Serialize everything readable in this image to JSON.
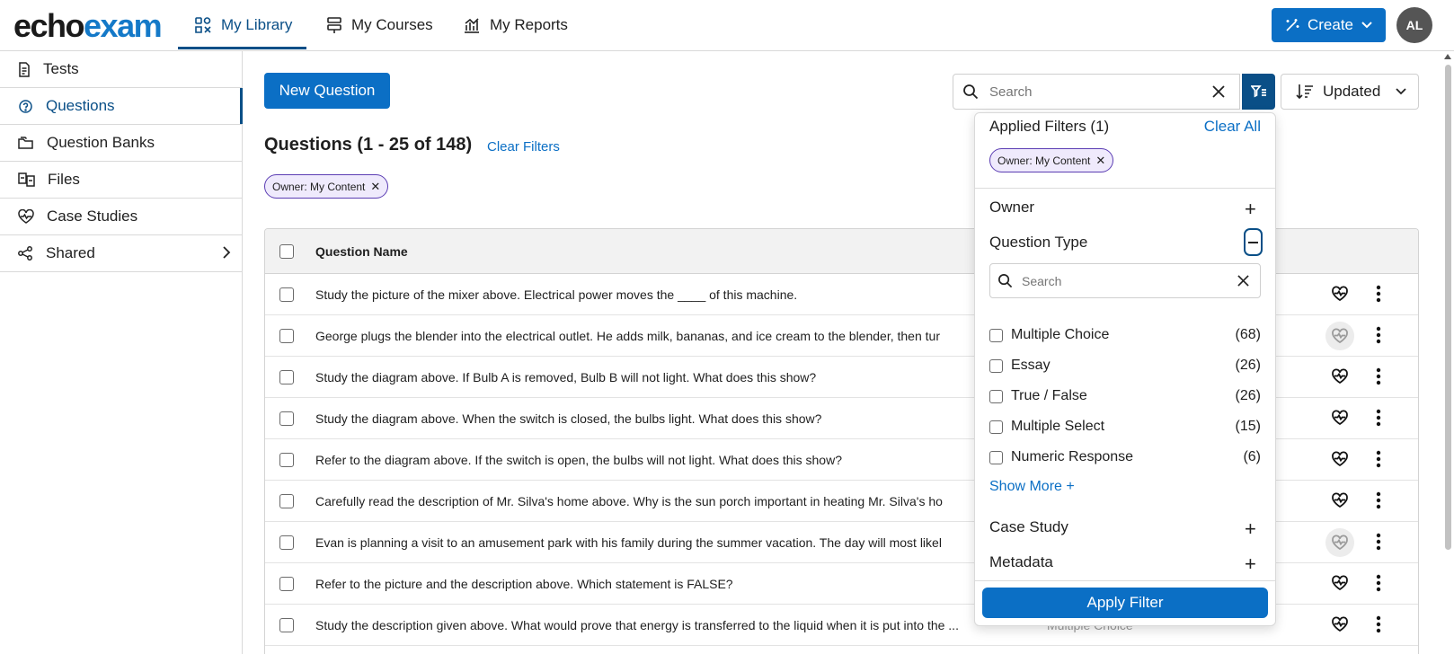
{
  "header": {
    "logo_part1": "echo",
    "logo_part2": "exam",
    "tabs": [
      {
        "label": "My Library",
        "icon": "library-icon"
      },
      {
        "label": "My Courses",
        "icon": "courses-icon"
      },
      {
        "label": "My Reports",
        "icon": "reports-icon"
      }
    ],
    "create_label": "Create",
    "avatar_initials": "AL",
    "accent_color": "#0b6fc5"
  },
  "sidebar": {
    "items": [
      {
        "label": "Tests",
        "icon": "document-icon"
      },
      {
        "label": "Questions",
        "icon": "question-gear-icon"
      },
      {
        "label": "Question Banks",
        "icon": "folder-icon"
      },
      {
        "label": "Files",
        "icon": "files-icon"
      },
      {
        "label": "Case Studies",
        "icon": "heart-pulse-icon"
      },
      {
        "label": "Shared",
        "icon": "share-icon"
      }
    ]
  },
  "main": {
    "new_question_label": "New Question",
    "title": "Questions (1 - 25 of 148)",
    "clear_filters_label": "Clear Filters",
    "chip_label": "Owner: My Content",
    "search_placeholder": "Search",
    "sort_label": "Updated",
    "table": {
      "column_question_name": "Question Name",
      "rows": [
        {
          "text": "Study the picture of the mixer above. Electrical power moves the ____ of this machine."
        },
        {
          "text": "George plugs the blender into the electrical outlet. He adds milk, bananas, and ice cream to the blender, then tur"
        },
        {
          "text": "Study the diagram above. If Bulb A is removed, Bulb B will not light. What does this show?"
        },
        {
          "text": "Study the diagram above. When the switch is closed, the bulbs light. What does this show?"
        },
        {
          "text": "Refer to the diagram above. If the switch is open, the bulbs will not light. What does this show?"
        },
        {
          "text": "Carefully read the description of Mr. Silva's home above. Why is the sun porch important in heating Mr. Silva's ho"
        },
        {
          "text": "Evan is planning a visit to an amusement park with his family during the summer vacation. The day will most likel"
        },
        {
          "text": "Refer to the picture and the description above. Which statement is FALSE?"
        },
        {
          "text": "Study the description given above. What would prove that energy is transferred to the liquid when it is put into the ..."
        }
      ],
      "last_row_type_label": "Multiple Choice"
    }
  },
  "filter_panel": {
    "applied_title": "Applied Filters (1)",
    "clear_all_label": "Clear All",
    "chip_label": "Owner: My Content",
    "owner_label": "Owner",
    "question_type_label": "Question Type",
    "search_placeholder": "Search",
    "options": [
      {
        "label": "Multiple Choice",
        "count": "(68)"
      },
      {
        "label": "Essay",
        "count": "(26)"
      },
      {
        "label": "True / False",
        "count": "(26)"
      },
      {
        "label": "Multiple Select",
        "count": "(15)"
      },
      {
        "label": "Numeric Response",
        "count": "(6)"
      }
    ],
    "show_more_label": "Show More +",
    "case_study_label": "Case Study",
    "metadata_label": "Metadata",
    "apply_label": "Apply Filter"
  }
}
